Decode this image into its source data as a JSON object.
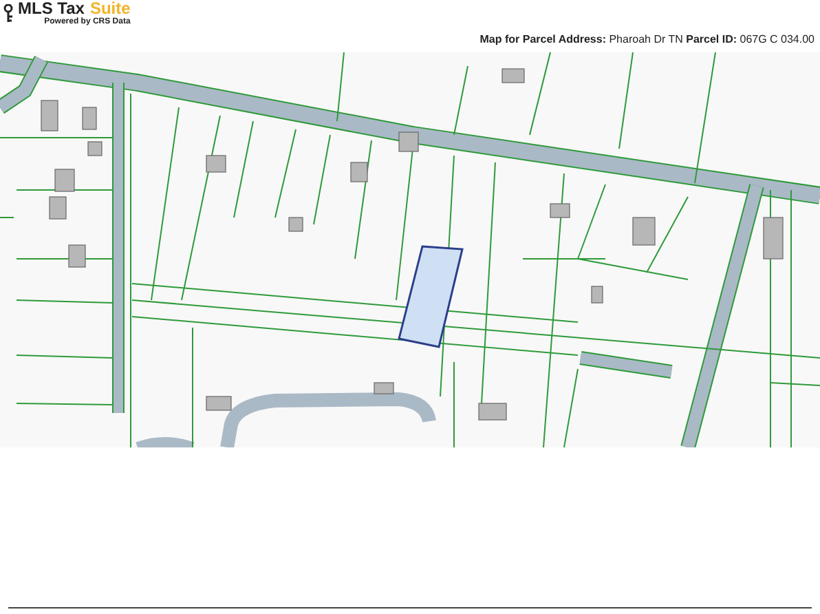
{
  "logo": {
    "brand": "MLS Tax",
    "product": "Suite",
    "tagline": "Powered by CRS Data"
  },
  "map_heading": "**Map for Parcel Address:** Pharoah Dr TN **Parcel ID:** 067G C 034.00"
}
